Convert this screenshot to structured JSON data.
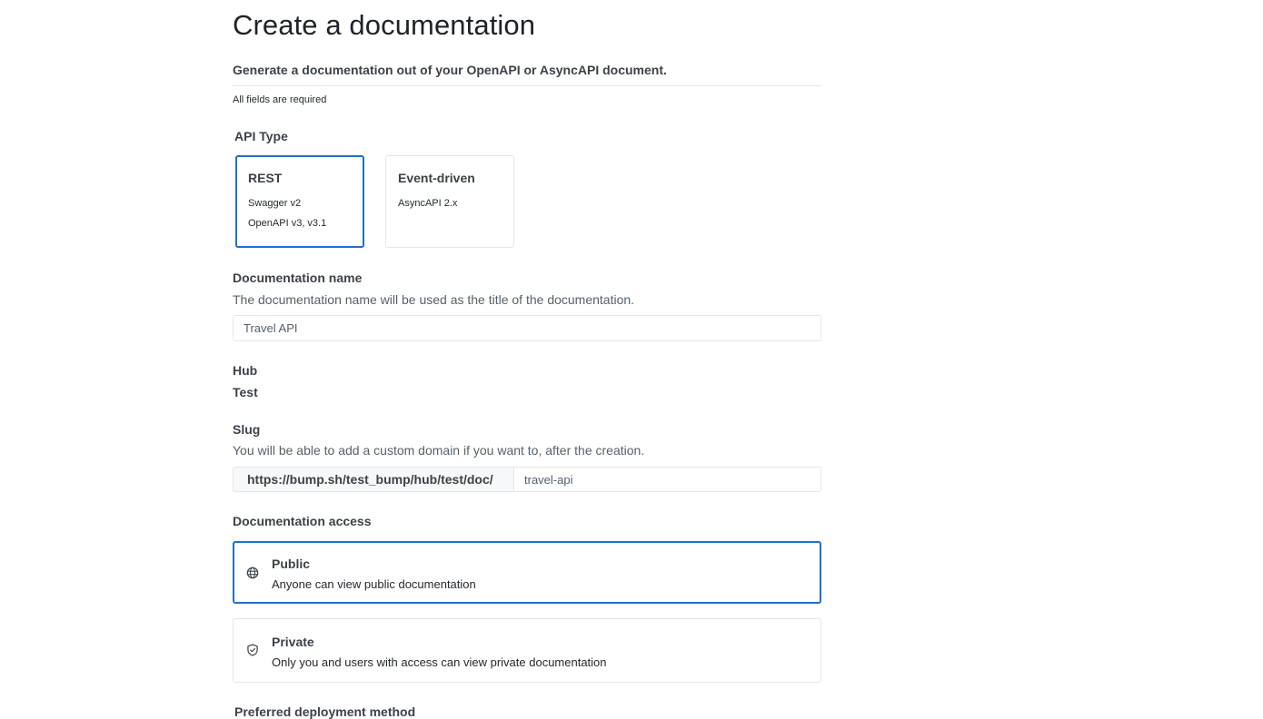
{
  "page": {
    "title": "Create a documentation",
    "subtitle": "Generate a documentation out of your OpenAPI or AsyncAPI document.",
    "required_note": "All fields are required"
  },
  "api_type": {
    "label": "API Type",
    "selected": "REST",
    "options": [
      {
        "title": "REST",
        "lines": [
          "Swagger v2",
          "OpenAPI v3, v3.1"
        ]
      },
      {
        "title": "Event-driven",
        "lines": [
          "AsyncAPI 2.x"
        ]
      }
    ]
  },
  "doc_name": {
    "label": "Documentation name",
    "help": "The documentation name will be used as the title of the documentation.",
    "value": "Travel API"
  },
  "hub": {
    "label": "Hub",
    "value": "Test"
  },
  "slug": {
    "label": "Slug",
    "help": "You will be able to add a custom domain if you want to, after the creation.",
    "prefix": "https://bump.sh/test_bump/hub/test/doc/",
    "value": "travel-api"
  },
  "access": {
    "label": "Documentation access",
    "selected": "Public",
    "options": [
      {
        "title": "Public",
        "description": "Anyone can view public documentation",
        "icon": "globe-icon"
      },
      {
        "title": "Private",
        "description": "Only you and users with access can view private documentation",
        "icon": "shield-check-icon"
      }
    ]
  },
  "deployment": {
    "label": "Preferred deployment method"
  },
  "colors": {
    "selected_border": "#1f6fce",
    "border": "#e4e6e9",
    "text": "#3d4248",
    "muted_text": "#57606a",
    "prefix_background": "#f6f8fa"
  }
}
